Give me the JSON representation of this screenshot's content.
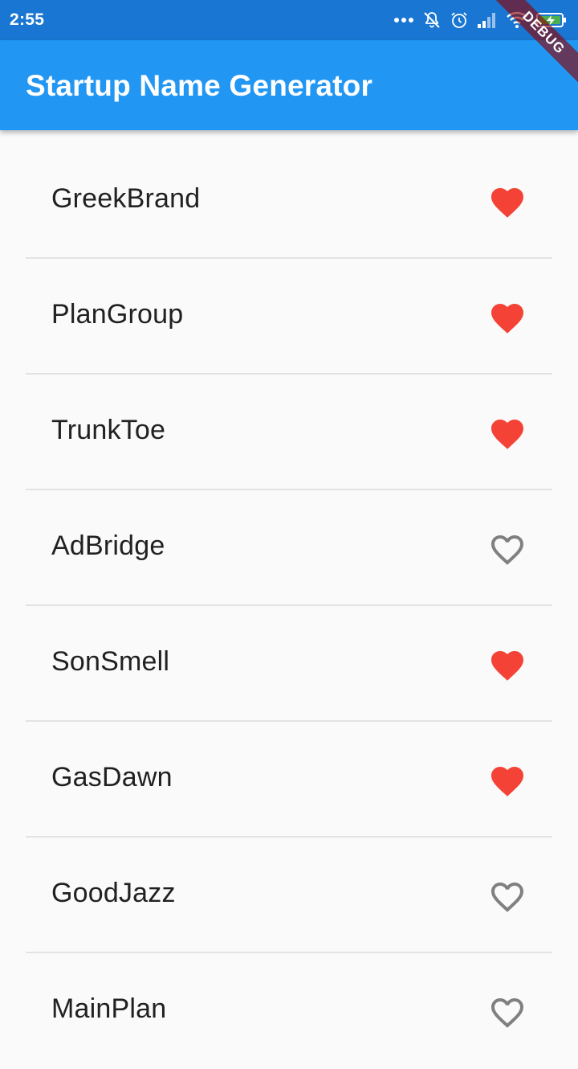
{
  "status_bar": {
    "time": "2:55"
  },
  "debug_banner": "DEBUG",
  "app_bar": {
    "title": "Startup Name Generator"
  },
  "colors": {
    "status_bar": "#1976d2",
    "app_bar": "#2196f3",
    "favorite": "#f44336",
    "not_favorite": "#808080",
    "background": "#fafafa"
  },
  "suggestions": [
    {
      "name": "GreekBrand",
      "favorite": true
    },
    {
      "name": "PlanGroup",
      "favorite": true
    },
    {
      "name": "TrunkToe",
      "favorite": true
    },
    {
      "name": "AdBridge",
      "favorite": false
    },
    {
      "name": "SonSmell",
      "favorite": true
    },
    {
      "name": "GasDawn",
      "favorite": true
    },
    {
      "name": "GoodJazz",
      "favorite": false
    },
    {
      "name": "MainPlan",
      "favorite": false
    }
  ]
}
